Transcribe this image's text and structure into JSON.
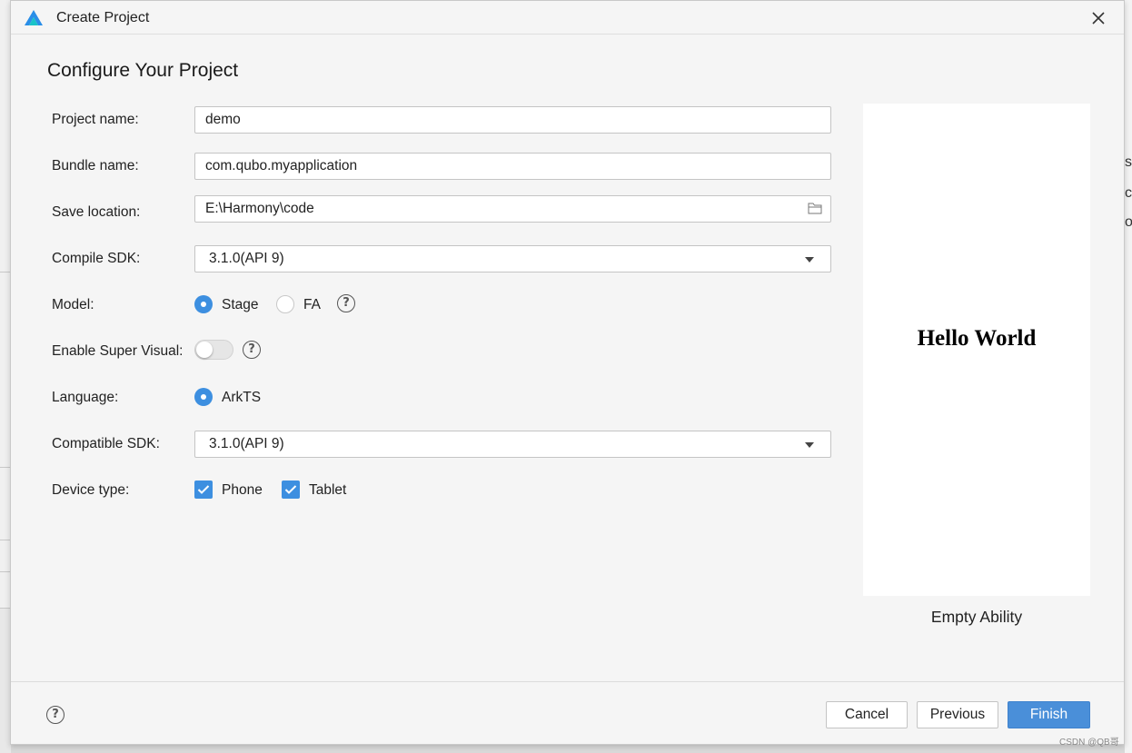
{
  "window": {
    "title": "Create Project"
  },
  "page": {
    "heading": "Configure Your Project"
  },
  "form": {
    "project_name": {
      "label": "Project name:",
      "value": "demo"
    },
    "bundle_name": {
      "label": "Bundle name:",
      "value": "com.qubo.myapplication"
    },
    "save_location": {
      "label": "Save location:",
      "value": "E:\\Harmony\\code"
    },
    "compile_sdk": {
      "label": "Compile SDK:",
      "selected": "3.1.0(API 9)"
    },
    "model": {
      "label": "Model:",
      "options": [
        "Stage",
        "FA"
      ],
      "selected": "Stage"
    },
    "super_visual": {
      "label": "Enable Super Visual:",
      "enabled": false
    },
    "language": {
      "label": "Language:",
      "options": [
        "ArkTS"
      ],
      "selected": "ArkTS"
    },
    "compatible_sdk": {
      "label": "Compatible SDK:",
      "selected": "3.1.0(API 9)"
    },
    "device_type": {
      "label": "Device type:",
      "options": [
        "Phone",
        "Tablet"
      ],
      "checked": [
        "Phone",
        "Tablet"
      ]
    }
  },
  "preview": {
    "text": "Hello World",
    "template_name": "Empty Ability"
  },
  "buttons": {
    "cancel": "Cancel",
    "previous": "Previous",
    "finish": "Finish"
  },
  "watermark": "CSDN @QB哥",
  "colors": {
    "accent": "#3d8fe0",
    "primary_button": "#4a8fd9",
    "dialog_bg": "#f5f5f5"
  },
  "icons": {
    "app": "harmony-logo-icon",
    "close": "close-icon",
    "folder": "folder-icon",
    "help": "help-icon",
    "dropdown": "chevron-down-icon"
  }
}
